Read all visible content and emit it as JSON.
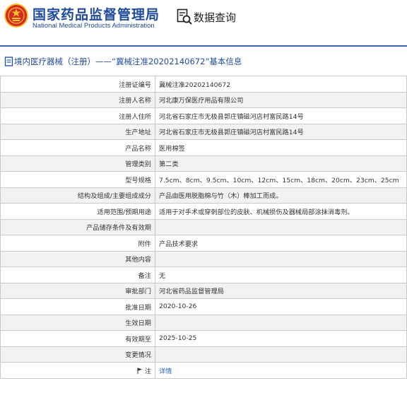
{
  "header": {
    "title_cn": "国家药品监督管理局",
    "title_en": "National Medical Products Administration",
    "query_label": "数据查询"
  },
  "section": {
    "title": "境内医疗器械（注册）——“冀械注准20202140672”基本信息"
  },
  "rows": [
    {
      "label": "注册证编号",
      "value": "冀械注准20202140672"
    },
    {
      "label": "注册人名称",
      "value": "河北康万保医疗用品有限公司"
    },
    {
      "label": "注册人住所",
      "value": "河北省石家庄市无极县郭庄镇磁河店村富民路14号"
    },
    {
      "label": "生产地址",
      "value": "河北省石家庄市无极县郭庄镇磁河店村富民路14号"
    },
    {
      "label": "产品名称",
      "value": "医用棉签"
    },
    {
      "label": "管理类别",
      "value": "第二类"
    },
    {
      "label": "型号规格",
      "value": "7.5cm、8cm、9.5cm、10cm、12cm、15cm、18cm、20cm、23cm、25cm"
    },
    {
      "label": "结构及组成/主要组成成分",
      "value": "产品由医用脱脂棉与竹（木）棒加工而成。"
    },
    {
      "label": "适用范围/预期用途",
      "value": "适用于对手术或穿刺部位的皮肤、机械损伤及器械局部涂抹消毒剂。"
    },
    {
      "label": "产品储存条件及有效期",
      "value": ""
    },
    {
      "label": "附件",
      "value": "产品技术要求"
    },
    {
      "label": "其他内容",
      "value": ""
    },
    {
      "label": "备注",
      "value": "无"
    },
    {
      "label": "审批部门",
      "value": "河北省药品监督管理局"
    },
    {
      "label": "批准日期",
      "value": "2020-10-26"
    },
    {
      "label": "生效日期",
      "value": ""
    },
    {
      "label": "有效期至",
      "value": "2025-10-25"
    },
    {
      "label": "变更情况",
      "value": ""
    },
    {
      "label": "注",
      "value": "详情"
    }
  ],
  "colors": {
    "brand_blue": "#1f4b9a",
    "emblem_red": "#d42a20",
    "emblem_gold": "#f2c230",
    "link_blue": "#1f5fbf",
    "grid_border": "#c9c9c9",
    "alt_row": "#f2f2f2"
  },
  "icons": {
    "emblem": "national-emblem-icon",
    "query": "magnifier-document-icon",
    "section": "document-icon",
    "note": "flag-icon"
  }
}
